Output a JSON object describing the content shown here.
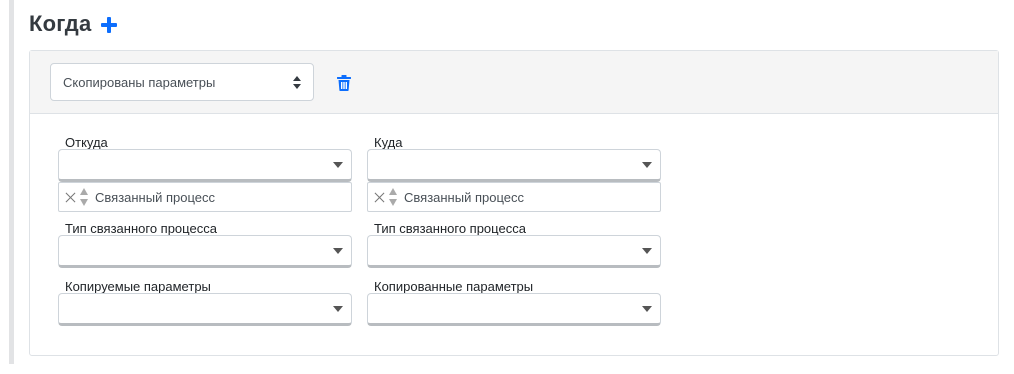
{
  "section": {
    "title": "Когда",
    "add_icon": "plus-icon"
  },
  "condition": {
    "type_value": "Скопированы параметры",
    "delete_icon": "trash-icon",
    "colors": {
      "accent": "#0d6efd",
      "header_bg": "#f5f5f5"
    }
  },
  "fields": {
    "from": {
      "label": "Откуда",
      "value": "",
      "related_label": "Связанный процесс"
    },
    "to": {
      "label": "Куда",
      "value": "",
      "related_label": "Связанный процесс"
    },
    "from_process_type": {
      "label": "Тип связанного процесса",
      "value": ""
    },
    "to_process_type": {
      "label": "Тип связанного процесса",
      "value": ""
    },
    "copied_from_params": {
      "label": "Копируемые параметры",
      "value": ""
    },
    "copied_to_params": {
      "label": "Копированные параметры",
      "value": ""
    }
  }
}
